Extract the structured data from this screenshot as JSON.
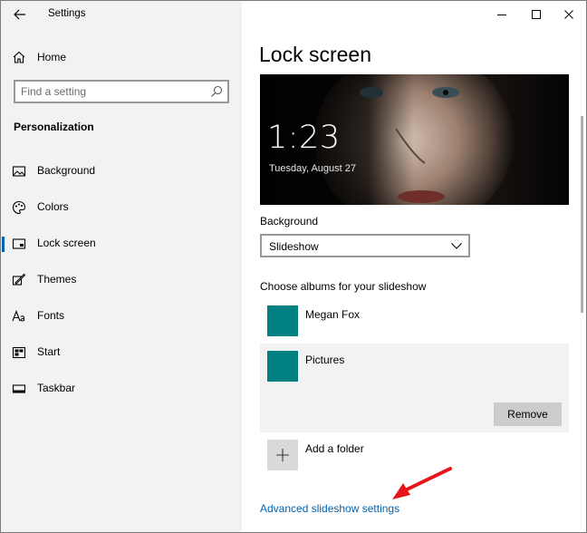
{
  "window": {
    "app_title": "Settings",
    "icons": {
      "back": "back-arrow-icon",
      "minimize": "minimize-icon",
      "maximize": "maximize-icon",
      "close": "close-icon"
    }
  },
  "sidebar": {
    "home_label": "Home",
    "search_placeholder": "Find a setting",
    "section_title": "Personalization",
    "items": [
      {
        "label": "Background",
        "icon": "picture-icon",
        "selected": false
      },
      {
        "label": "Colors",
        "icon": "palette-icon",
        "selected": false
      },
      {
        "label": "Lock screen",
        "icon": "lock-screen-icon",
        "selected": true
      },
      {
        "label": "Themes",
        "icon": "themes-icon",
        "selected": false
      },
      {
        "label": "Fonts",
        "icon": "fonts-icon",
        "selected": false
      },
      {
        "label": "Start",
        "icon": "start-icon",
        "selected": false
      },
      {
        "label": "Taskbar",
        "icon": "taskbar-icon",
        "selected": false
      }
    ]
  },
  "main": {
    "page_title": "Lock screen",
    "preview": {
      "time": "1:23",
      "date": "Tuesday, August 27"
    },
    "background_label": "Background",
    "background_value": "Slideshow",
    "albums_label": "Choose albums for your slideshow",
    "albums": [
      {
        "name": "Megan Fox",
        "selected": false
      },
      {
        "name": "Pictures",
        "selected": true
      }
    ],
    "remove_label": "Remove",
    "add_folder_label": "Add a folder",
    "advanced_link": "Advanced slideshow settings"
  },
  "colors": {
    "accent": "#0063b1",
    "album_tile": "#008080",
    "annotation_arrow": "#e8141b"
  }
}
